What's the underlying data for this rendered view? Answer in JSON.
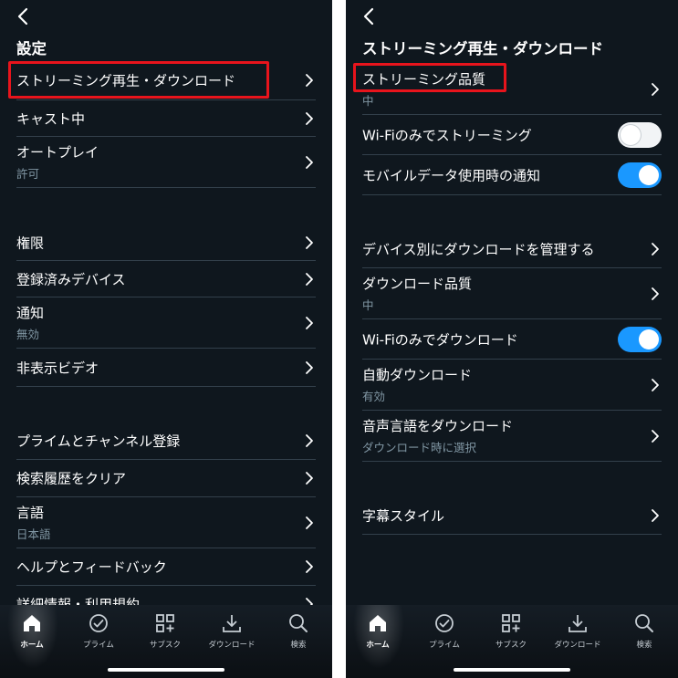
{
  "left": {
    "title": "設定",
    "items": [
      {
        "label": "ストリーミング再生・ダウンロード"
      },
      {
        "label": "キャスト中"
      },
      {
        "label": "オートプレイ",
        "sub": "許可"
      },
      {
        "label": "権限"
      },
      {
        "label": "登録済みデバイス"
      },
      {
        "label": "通知",
        "sub": "無効"
      },
      {
        "label": "非表示ビデオ"
      },
      {
        "label": "プライムとチャンネル登録"
      },
      {
        "label": "検索履歴をクリア"
      },
      {
        "label": "言語",
        "sub": "日本語"
      },
      {
        "label": "ヘルプとフィードバック"
      },
      {
        "label": "詳細情報・利用規約"
      }
    ]
  },
  "right": {
    "title": "ストリーミング再生・ダウンロード",
    "items": [
      {
        "label": "ストリーミング品質",
        "sub": "中"
      },
      {
        "label": "Wi-Fiのみでストリーミング",
        "toggle": false
      },
      {
        "label": "モバイルデータ使用時の通知",
        "toggle": true
      },
      {
        "label": "デバイス別にダウンロードを管理する"
      },
      {
        "label": "ダウンロード品質",
        "sub": "中"
      },
      {
        "label": "Wi-Fiのみでダウンロード",
        "toggle": true
      },
      {
        "label": "自動ダウンロード",
        "sub": "有効"
      },
      {
        "label": "音声言語をダウンロード",
        "sub": "ダウンロード時に選択"
      },
      {
        "label": "字幕スタイル"
      }
    ]
  },
  "nav": [
    {
      "label": "ホーム",
      "icon": "home-icon",
      "active": true
    },
    {
      "label": "プライム",
      "icon": "check-circle-icon"
    },
    {
      "label": "サブスク",
      "icon": "grid-plus-icon"
    },
    {
      "label": "ダウンロード",
      "icon": "download-icon"
    },
    {
      "label": "検索",
      "icon": "search-icon"
    }
  ],
  "colors": {
    "background": "#0f171e",
    "accent": "#1a98ff",
    "highlight": "#e8141c",
    "divider": "#33404b",
    "subtext": "#8197a4"
  }
}
